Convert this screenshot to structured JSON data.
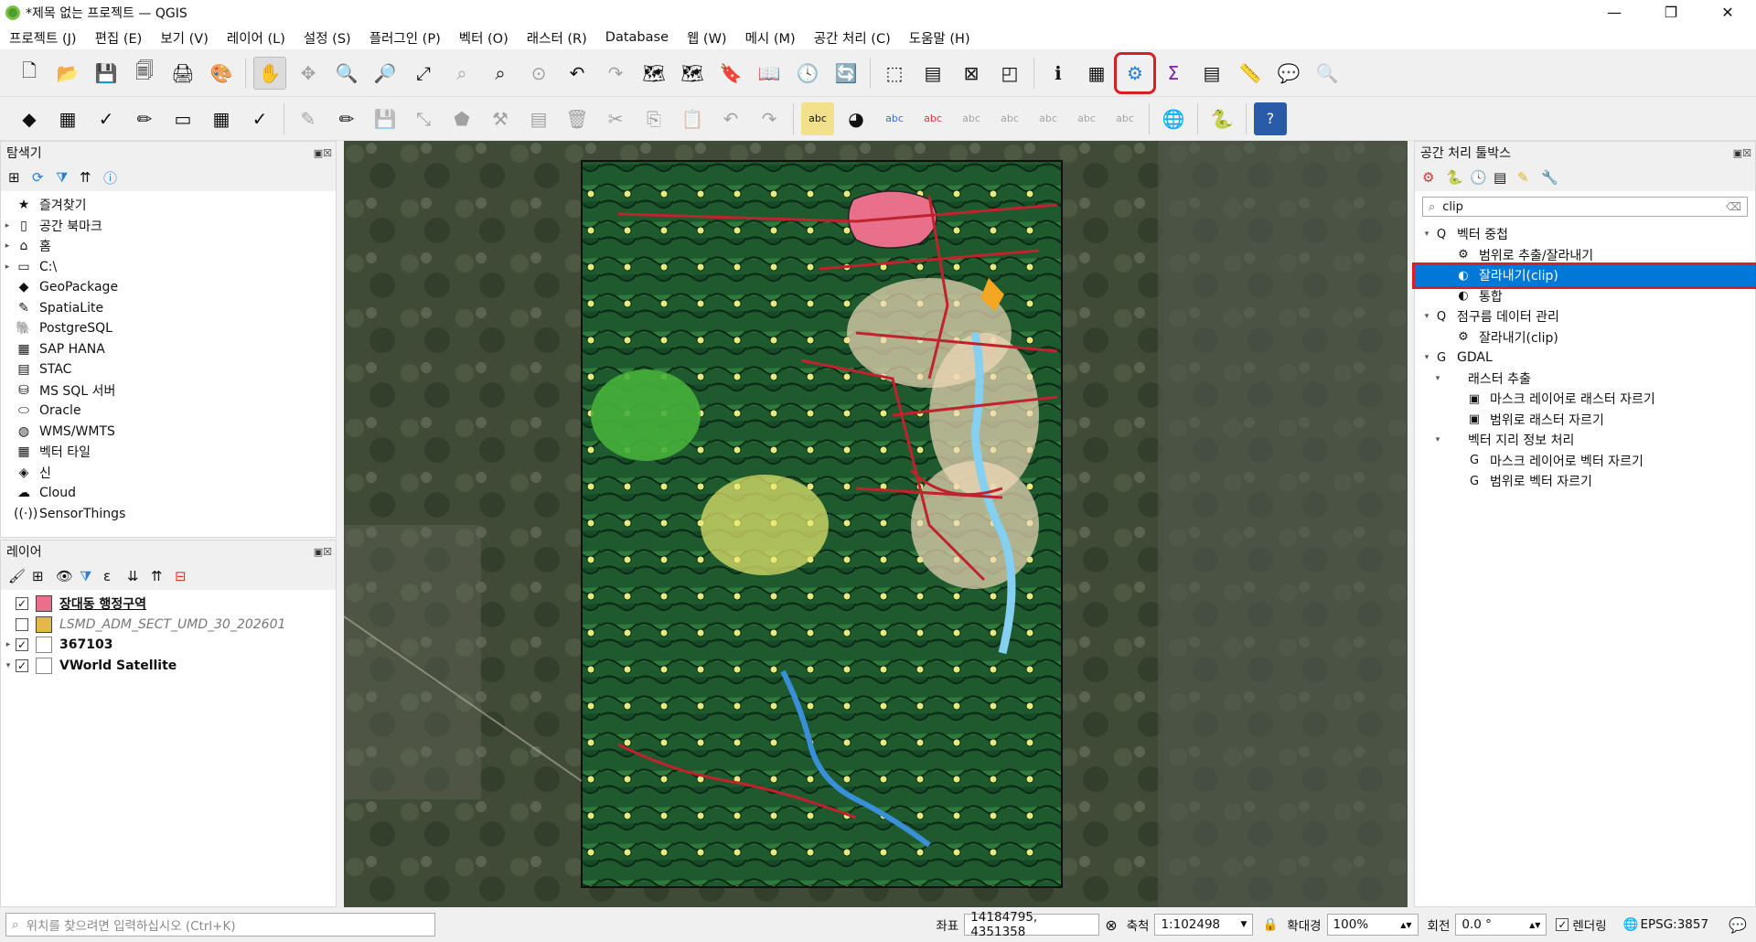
{
  "window": {
    "title": "*제목 없는 프로젝트 — QGIS",
    "min": "—",
    "max": "❐",
    "close": "✕"
  },
  "menu": [
    "프로젝트 (J)",
    "편집 (E)",
    "보기 (V)",
    "레이어 (L)",
    "설정 (S)",
    "플러그인 (P)",
    "벡터 (O)",
    "래스터 (R)",
    "Database",
    "웹 (W)",
    "메시 (M)",
    "공간 처리 (C)",
    "도움말 (H)"
  ],
  "browser": {
    "title": "탐색기",
    "items": [
      {
        "label": "즐겨찾기",
        "icon": "★",
        "arrow": ""
      },
      {
        "label": "공간 북마크",
        "icon": "▯",
        "arrow": "▸"
      },
      {
        "label": "홈",
        "icon": "⌂",
        "arrow": "▸"
      },
      {
        "label": "C:\\",
        "icon": "▭",
        "arrow": "▸"
      },
      {
        "label": "GeoPackage",
        "icon": "◆",
        "arrow": ""
      },
      {
        "label": "SpatiaLite",
        "icon": "✎",
        "arrow": ""
      },
      {
        "label": "PostgreSQL",
        "icon": "🐘",
        "arrow": ""
      },
      {
        "label": "SAP HANA",
        "icon": "▦",
        "arrow": ""
      },
      {
        "label": "STAC",
        "icon": "▤",
        "arrow": ""
      },
      {
        "label": "MS SQL 서버",
        "icon": "⛁",
        "arrow": ""
      },
      {
        "label": "Oracle",
        "icon": "⬭",
        "arrow": ""
      },
      {
        "label": "WMS/WMTS",
        "icon": "◍",
        "arrow": ""
      },
      {
        "label": "벡터 타일",
        "icon": "▦",
        "arrow": ""
      },
      {
        "label": "신",
        "icon": "◈",
        "arrow": ""
      },
      {
        "label": "Cloud",
        "icon": "☁",
        "arrow": ""
      },
      {
        "label": "SensorThings",
        "icon": "((·))",
        "arrow": ""
      }
    ]
  },
  "layers": {
    "title": "레이어",
    "items": [
      {
        "label": "장대동 행정구역",
        "checked": "✓",
        "color": "#e8708a",
        "style": "bold ul",
        "arrow": ""
      },
      {
        "label": "LSMD_ADM_SECT_UMD_30_202601",
        "checked": "",
        "color": "#e5b84a",
        "style": "it",
        "arrow": ""
      },
      {
        "label": "367103",
        "checked": "✓",
        "color": "",
        "style": "bold",
        "arrow": "▸"
      },
      {
        "label": "VWorld Satellite",
        "checked": "✓",
        "color": "",
        "style": "bold",
        "arrow": "▾"
      }
    ]
  },
  "toolbox": {
    "title": "공간 처리 툴박스",
    "search_value": "clip",
    "nodes": [
      {
        "label": "벡터 중첩",
        "indent": 0,
        "arrow": "▾",
        "icon": "Q",
        "selected": false
      },
      {
        "label": "범위로 추출/잘라내기",
        "indent": 2,
        "arrow": "",
        "icon": "⚙",
        "selected": false
      },
      {
        "label": "잘라내기(clip)",
        "indent": 2,
        "arrow": "",
        "icon": "◐",
        "selected": true
      },
      {
        "label": "통합",
        "indent": 2,
        "arrow": "",
        "icon": "◐",
        "selected": false
      },
      {
        "label": "점구름 데이터 관리",
        "indent": 0,
        "arrow": "▾",
        "icon": "Q",
        "selected": false
      },
      {
        "label": "잘라내기(clip)",
        "indent": 2,
        "arrow": "",
        "icon": "⚙",
        "selected": false
      },
      {
        "label": "GDAL",
        "indent": 0,
        "arrow": "▾",
        "icon": "G",
        "selected": false
      },
      {
        "label": "래스터 추출",
        "indent": 1,
        "arrow": "▾",
        "icon": "",
        "selected": false
      },
      {
        "label": "마스크 레이어로 래스터 자르기",
        "indent": 3,
        "arrow": "",
        "icon": "▣",
        "selected": false
      },
      {
        "label": "범위로 래스터 자르기",
        "indent": 3,
        "arrow": "",
        "icon": "▣",
        "selected": false
      },
      {
        "label": "벡터 지리 정보 처리",
        "indent": 1,
        "arrow": "▾",
        "icon": "",
        "selected": false
      },
      {
        "label": "마스크 레이어로 벡터 자르기",
        "indent": 3,
        "arrow": "",
        "icon": "G",
        "selected": false
      },
      {
        "label": "범위로 벡터 자르기",
        "indent": 3,
        "arrow": "",
        "icon": "G",
        "selected": false
      }
    ]
  },
  "status": {
    "locator_placeholder": "위치를 찾으려면 입력하십시오 (Ctrl+K)",
    "coord_label": "좌표",
    "coord_value": "14184795, 4351358",
    "scale_label": "축척",
    "scale_value": "1:102498",
    "magnifier_label": "확대경",
    "magnifier_value": "100%",
    "rotation_label": "회전",
    "rotation_value": "0.0 °",
    "render_label": "렌더링",
    "crs": "EPSG:3857"
  }
}
